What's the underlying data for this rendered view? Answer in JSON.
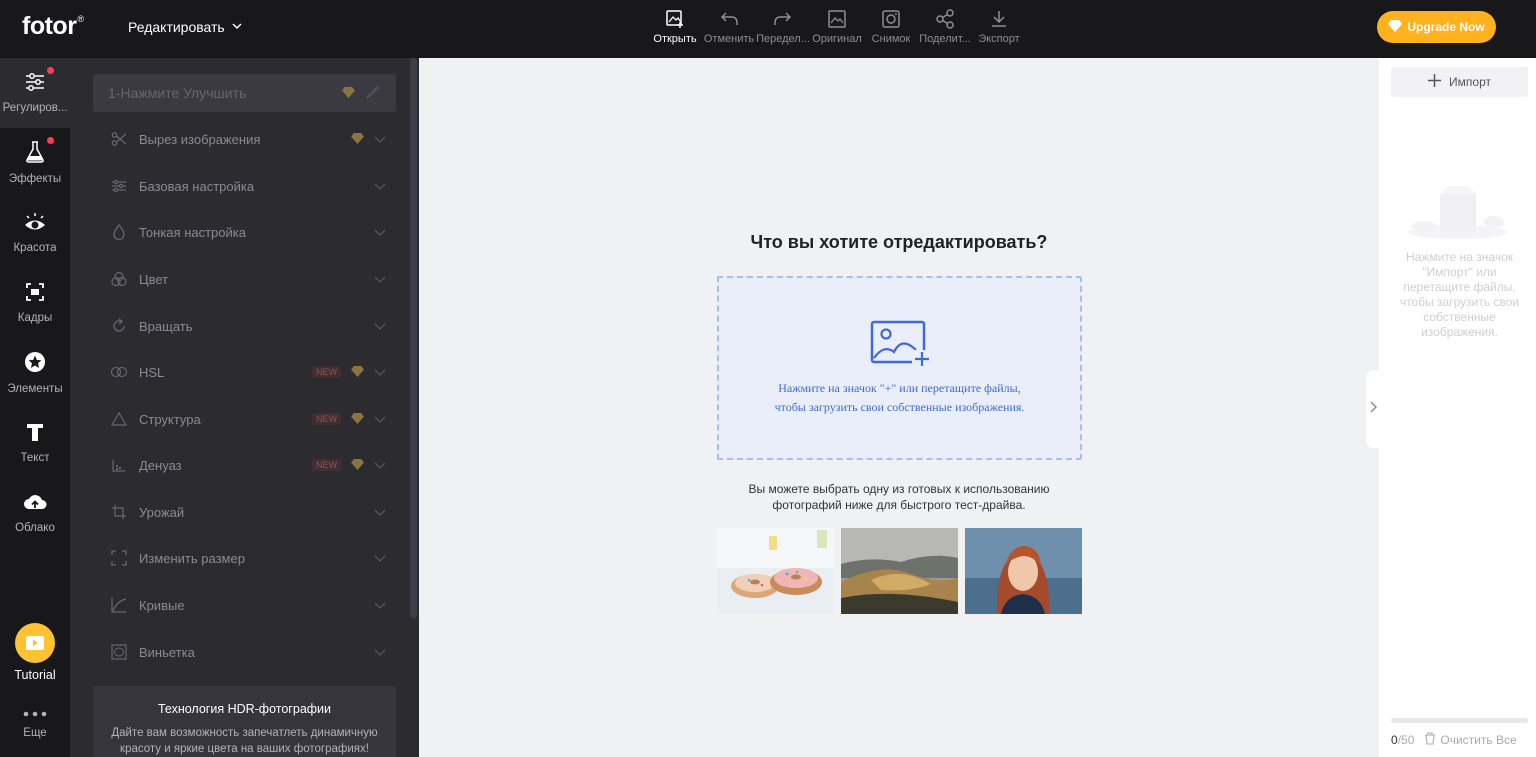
{
  "app": {
    "logo": "fotor",
    "logo_mark": "®"
  },
  "header": {
    "edit_menu": "Редактировать",
    "tools": [
      {
        "label": "Открыть",
        "icon": "open-image-icon",
        "active": true
      },
      {
        "label": "Отменить",
        "icon": "undo-icon"
      },
      {
        "label": "Передел...",
        "icon": "redo-icon"
      },
      {
        "label": "Оригинал",
        "icon": "original-icon"
      },
      {
        "label": "Снимок",
        "icon": "snapshot-icon"
      },
      {
        "label": "Поделит...",
        "icon": "share-icon"
      },
      {
        "label": "Экспорт",
        "icon": "export-icon"
      }
    ],
    "upgrade": "Upgrade Now"
  },
  "rail": {
    "items": [
      {
        "label": "Регулиров...",
        "icon": "sliders-icon",
        "dot": true
      },
      {
        "label": "Эффекты",
        "icon": "flask-icon",
        "dot": true
      },
      {
        "label": "Красота",
        "icon": "eye-icon"
      },
      {
        "label": "Кадры",
        "icon": "frame-icon"
      },
      {
        "label": "Элементы",
        "icon": "star-icon"
      },
      {
        "label": "Текст",
        "icon": "text-icon"
      },
      {
        "label": "Облако",
        "icon": "cloud-icon"
      }
    ],
    "tutorial": "Tutorial",
    "more": "Еще"
  },
  "adjust": {
    "enhance": "1-Нажмите Улучшить",
    "items": [
      {
        "label": "Вырез изображения",
        "icon": "scissors-icon",
        "premium": true
      },
      {
        "label": "Базовая настройка",
        "icon": "sliders-icon"
      },
      {
        "label": "Тонкая настройка",
        "icon": "drop-icon"
      },
      {
        "label": "Цвет",
        "icon": "color-circles-icon"
      },
      {
        "label": "Вращать",
        "icon": "rotate-icon"
      },
      {
        "label": "HSL",
        "icon": "hsl-icon",
        "new": "NEW",
        "premium": true
      },
      {
        "label": "Структура",
        "icon": "triangle-icon",
        "new": "NEW",
        "premium": true
      },
      {
        "label": "Денуаз",
        "icon": "denoise-icon",
        "new": "NEW",
        "premium": true
      },
      {
        "label": "Урожай",
        "icon": "crop-icon"
      },
      {
        "label": "Изменить размер",
        "icon": "resize-icon"
      },
      {
        "label": "Кривые",
        "icon": "curves-icon"
      },
      {
        "label": "Виньетка",
        "icon": "vignette-icon"
      }
    ],
    "hdr_title": "Технология HDR-фотографии",
    "hdr_desc": "Дайте вам возможность запечатлеть динамичную красоту и яркие цвета на ваших фотографиях!"
  },
  "canvas": {
    "question": "Что вы хотите отредактировать?",
    "drop_line1": "Нажмите на значок \"+\" или перетащите файлы,",
    "drop_line2": "чтобы загрузить свои собственные изображения.",
    "sample_line1": "Вы можете выбрать одну из готовых к использованию",
    "sample_line2": "фотографий ниже для быстрого тест-драйва.",
    "samples": [
      "donuts-photo",
      "landscape-photo",
      "portrait-photo"
    ]
  },
  "right_panel": {
    "import": "Импорт",
    "hint": "Нажмите на значок \"Импорт\" или перетащите файлы, чтобы загрузить свои собственные изображения.",
    "count": "0",
    "total": "/50",
    "clear": "Очистить Все"
  },
  "colors": {
    "accent": "#ffb21e",
    "drop_text": "#3f6ad8",
    "new_badge": "#a44b4b",
    "dot": "#ff3b5c"
  }
}
